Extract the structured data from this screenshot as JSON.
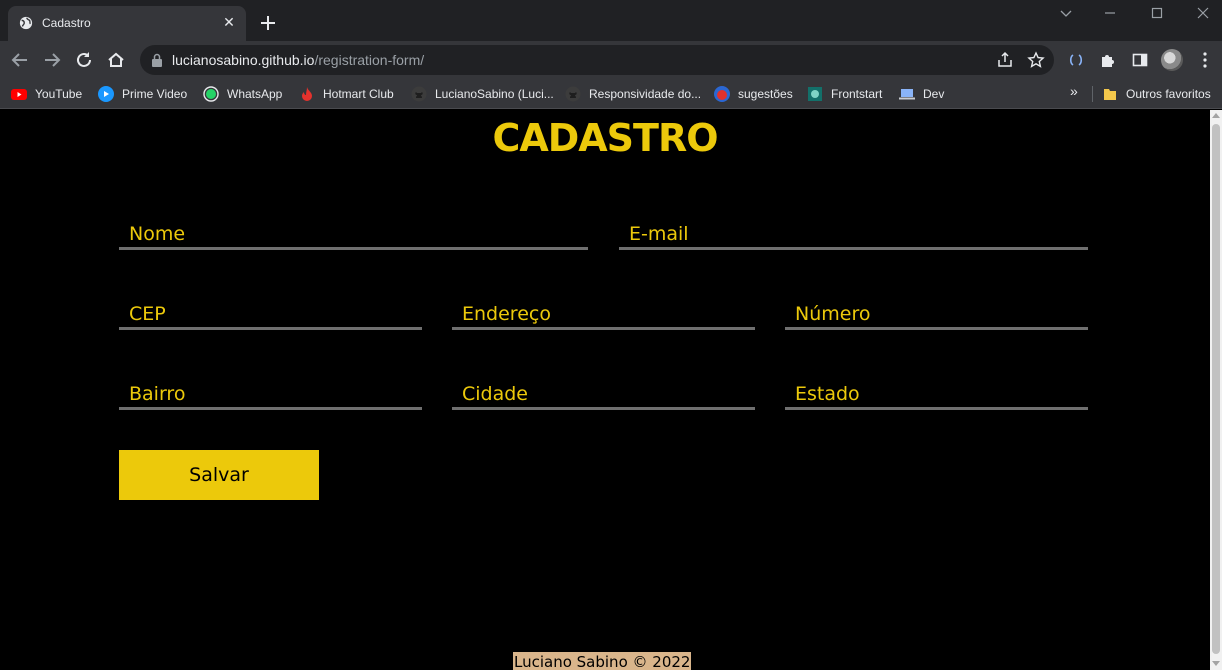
{
  "browser": {
    "tab": {
      "title": "Cadastro"
    },
    "url": {
      "host": "lucianosabino.github.io",
      "path": "/registration-form/"
    },
    "bookmarks": [
      {
        "label": "YouTube",
        "icon": "youtube-icon"
      },
      {
        "label": "Prime Video",
        "icon": "prime-video-icon"
      },
      {
        "label": "WhatsApp",
        "icon": "whatsapp-icon"
      },
      {
        "label": "Hotmart Club",
        "icon": "hotmart-icon"
      },
      {
        "label": "LucianoSabino (Luci...",
        "icon": "github-icon"
      },
      {
        "label": "Responsividade do...",
        "icon": "github-icon"
      },
      {
        "label": "sugestões",
        "icon": "bookmark-icon"
      },
      {
        "label": "Frontstart",
        "icon": "frontstart-icon"
      },
      {
        "label": "Dev",
        "icon": "laptop-icon"
      }
    ],
    "more": "»",
    "other_bookmarks": "Outros favoritos"
  },
  "page": {
    "title": "CADASTRO",
    "fields": {
      "nome": "Nome",
      "email": "E-mail",
      "cep": "CEP",
      "endereco": "Endereço",
      "numero": "Número",
      "bairro": "Bairro",
      "cidade": "Cidade",
      "estado": "Estado"
    },
    "save_label": "Salvar",
    "footer": "Luciano Sabino © 2022"
  },
  "colors": {
    "accent": "#ecc90b",
    "background": "#000000",
    "field_border": "#6f6f6f",
    "footer_bg": "#d9b58b"
  }
}
